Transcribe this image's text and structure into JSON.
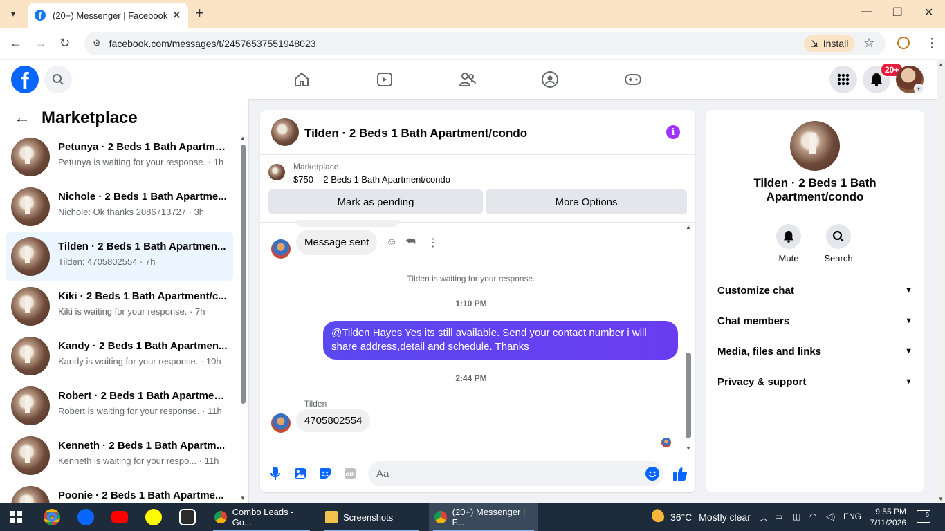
{
  "browser": {
    "tab_title": "(20+) Messenger | Facebook",
    "url": "facebook.com/messages/t/24576537551948023",
    "install_label": "Install"
  },
  "fb_header": {
    "notification_count": "20+"
  },
  "left": {
    "title": "Marketplace",
    "conversations": [
      {
        "name": "Petunya · 2 Beds 1 Bath Apartme...",
        "preview": "Petunya is waiting for your response. · 1h",
        "active": false
      },
      {
        "name": "Nichole · 2 Beds 1 Bath Apartme...",
        "preview": "Nichole: Ok thanks 2086713727 · 3h",
        "active": false
      },
      {
        "name": "Tilden · 2 Beds 1 Bath Apartmen...",
        "preview": "Tilden: 4705802554 · 7h",
        "active": true
      },
      {
        "name": "Kiki · 2 Beds 1 Bath Apartment/c...",
        "preview": "Kiki is waiting for your response. · 7h",
        "active": false
      },
      {
        "name": "Kandy · 2 Beds 1 Bath Apartmen...",
        "preview": "Kandy is waiting for your response. · 10h",
        "active": false
      },
      {
        "name": "Robert · 2 Beds 1 Bath Apartmen...",
        "preview": "Robert is waiting for your response. · 11h",
        "active": false
      },
      {
        "name": "Kenneth · 2 Beds 1 Bath Apartm...",
        "preview": "Kenneth is waiting for your respo... · 11h",
        "active": false
      },
      {
        "name": "Poonie · 2 Beds 1 Bath Apartme...",
        "preview": "",
        "active": false
      }
    ]
  },
  "chat": {
    "title": "Tilden · 2 Beds 1 Bath Apartment/condo",
    "marketplace_label": "Marketplace",
    "listing": "$750 – 2 Beds 1 Bath Apartment/condo",
    "mark_pending": "Mark as pending",
    "more_options": "More Options",
    "messages": {
      "sent_notice": "Message sent",
      "waiting": "Tilden is waiting for your response.",
      "time1": "1:10 PM",
      "outgoing": "@Tilden Hayes Yes its still available. Send your contact number i will share address,detail and schedule. Thanks",
      "time2": "2:44 PM",
      "sender": "Tilden",
      "incoming": "4705802554"
    },
    "composer_placeholder": "Aa"
  },
  "info": {
    "name": "Tilden · 2 Beds 1 Bath Apartment/condo",
    "mute": "Mute",
    "search": "Search",
    "rows": [
      "Customize chat",
      "Chat members",
      "Media, files and links",
      "Privacy & support"
    ]
  },
  "taskbar": {
    "task1": "Combo Leads - Go...",
    "task2": "Screenshots",
    "task3": "(20+) Messenger | F...",
    "temp": "36°C",
    "weather": "Mostly clear",
    "lang": "ENG",
    "time": "9:55 PM",
    "date": "7/11/2026",
    "notif_count": "6"
  }
}
